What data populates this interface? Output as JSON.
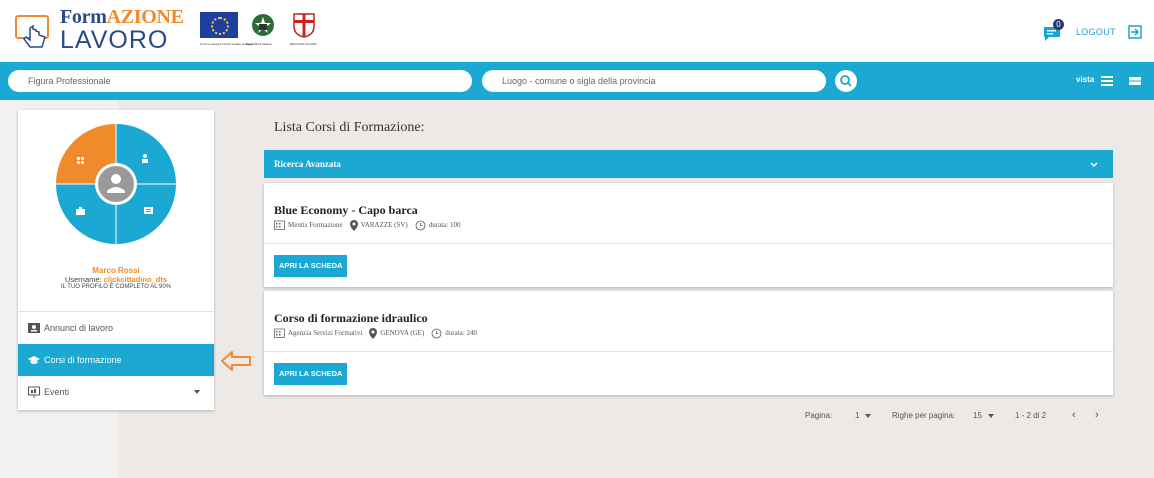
{
  "header": {
    "logo_top_a": "Form",
    "logo_top_b": "AZIONE",
    "logo_bottom": "LAVORO",
    "flag_caption_eu": "Unione europea Fondo sociale europeo",
    "flag_caption_it": "Repubblica Italiana",
    "flag_caption_lig": "REGIONE LIGURIA",
    "notification_count": "0",
    "logout_label": "LOGOUT"
  },
  "search": {
    "profession_placeholder": "Figura Professionale",
    "location_placeholder": "Luogo - comune o sigla della provincia",
    "vista_label": "vista"
  },
  "user": {
    "name": "Marco Rossi",
    "username_label": "Username: ",
    "username": "clickcittadino_dts",
    "profile_status": "IL TUO PROFILO È COMPLETO AL 90%"
  },
  "menu": {
    "items": [
      {
        "label": "Annunci di lavoro"
      },
      {
        "label": "Corsi di formazione"
      },
      {
        "label": "Eventi"
      }
    ]
  },
  "main": {
    "title": "Lista Corsi di Formazione:",
    "advanced_search": "Ricerca Avanzata",
    "courses": [
      {
        "title": "Blue Economy - Capo barca",
        "provider": "Mentis Formazione",
        "location": "VARAZZE (SV)",
        "duration": "durata: 100",
        "button": "APRI LA SCHEDA"
      },
      {
        "title": "Corso di formazione idraulico",
        "provider": "Agenzia Servizi Formativi",
        "location": "GENOVA (GE)",
        "duration": "durata: 240",
        "button": "APRI LA SCHEDA"
      }
    ]
  },
  "pagination": {
    "page_label": "Pagina:",
    "page_value": "1",
    "rows_label": "Righe per pagina:",
    "rows_value": "15",
    "range": "1 - 2 di 2",
    "prev": "‹",
    "next": "›"
  },
  "colors": {
    "primary": "#1ba8d2",
    "accent": "#f08a2a",
    "brand_dark": "#2b4a8a"
  }
}
